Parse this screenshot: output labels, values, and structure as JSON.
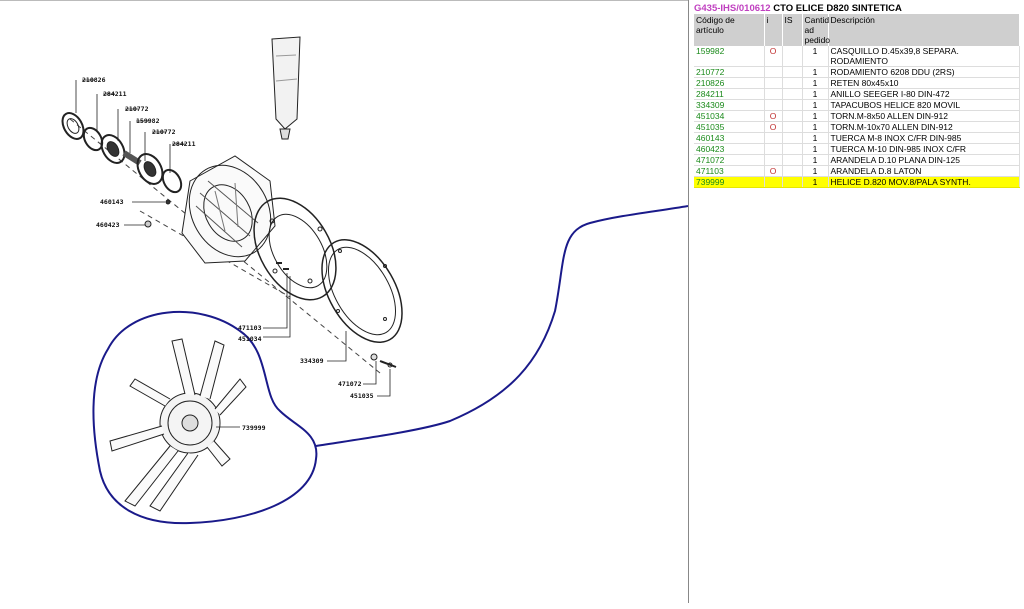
{
  "header": {
    "code": "G435-IHS/010612",
    "name": "CTO ELICE D820 SINTETICA"
  },
  "columns": {
    "codigo": "Código de artículo",
    "i": "i",
    "is": "IS",
    "cantidad": "Cantid ad pedido",
    "descripcion": "Descripción"
  },
  "rows": [
    {
      "code": "159982",
      "i": "O",
      "is": "",
      "qty": "1",
      "desc": "CASQUILLO D.45x39,8 SEPARA. RODAMIENTO"
    },
    {
      "code": "210772",
      "i": "",
      "is": "",
      "qty": "1",
      "desc": "RODAMIENTO 6208 DDU (2RS)"
    },
    {
      "code": "210826",
      "i": "",
      "is": "",
      "qty": "1",
      "desc": "RETEN 80x45x10"
    },
    {
      "code": "284211",
      "i": "",
      "is": "",
      "qty": "1",
      "desc": "ANILLO SEEGER I-80 DIN-472"
    },
    {
      "code": "334309",
      "i": "",
      "is": "",
      "qty": "1",
      "desc": "TAPACUBOS HELICE 820 MOVIL"
    },
    {
      "code": "451034",
      "i": "O",
      "is": "",
      "qty": "1",
      "desc": "TORN.M-8x50 ALLEN DIN-912"
    },
    {
      "code": "451035",
      "i": "O",
      "is": "",
      "qty": "1",
      "desc": "TORN.M-10x70 ALLEN DIN-912"
    },
    {
      "code": "460143",
      "i": "",
      "is": "",
      "qty": "1",
      "desc": "TUERCA M-8 INOX C/FR DIN-985"
    },
    {
      "code": "460423",
      "i": "",
      "is": "",
      "qty": "1",
      "desc": "TUERCA M-10 DIN-985 INOX C/FR"
    },
    {
      "code": "471072",
      "i": "",
      "is": "",
      "qty": "1",
      "desc": "ARANDELA D.10 PLANA DIN-125"
    },
    {
      "code": "471103",
      "i": "O",
      "is": "",
      "qty": "1",
      "desc": "ARANDELA D.8 LATON"
    },
    {
      "code": "739999",
      "i": "",
      "is": "",
      "qty": "1",
      "desc": "HELICE D.820 MOV.8/PALA SYNTH."
    }
  ],
  "highlight_code": "739999",
  "callouts": {
    "c210826": "210826",
    "c284211a": "284211",
    "c210772a": "210772",
    "c159982": "159982",
    "c210772b": "210772",
    "c284211b": "284211",
    "c460143": "460143",
    "c460423": "460423",
    "c471103": "471103",
    "c451034": "451034",
    "c334309": "334309",
    "c471072": "471072",
    "c451035": "451035",
    "c739999": "739999"
  },
  "colors": {
    "highlight": "#ffff00",
    "code_text": "#1a8a1a",
    "indicator": "#c03030",
    "title_code": "#c040c0",
    "circle_annotation": "#1a1a8a"
  }
}
